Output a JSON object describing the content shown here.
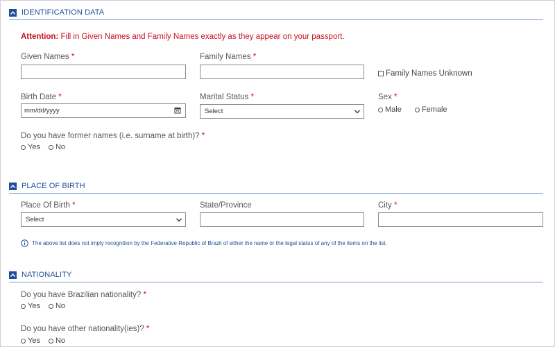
{
  "sections": {
    "identification": {
      "title": "IDENTIFICATION DATA"
    },
    "place_of_birth": {
      "title": "PLACE OF BIRTH"
    },
    "nationality": {
      "title": "NATIONALITY"
    }
  },
  "attention": {
    "label": "Attention:",
    "text": "Fill in Given Names and Family Names exactly as they appear on your passport."
  },
  "fields": {
    "given_names": {
      "label": "Given Names",
      "value": ""
    },
    "family_names": {
      "label": "Family Names",
      "value": ""
    },
    "family_names_unknown": {
      "label": "Family Names Unknown"
    },
    "birth_date": {
      "label": "Birth Date",
      "placeholder": "mm/dd/yyyy"
    },
    "marital_status": {
      "label": "Marital Status",
      "value": "Select"
    },
    "sex": {
      "label": "Sex",
      "options": [
        "Male",
        "Female"
      ]
    },
    "former_names": {
      "label": "Do you have former names (i.e. surname at birth)?",
      "options": [
        "Yes",
        "No"
      ]
    },
    "place_of_birth": {
      "label": "Place Of Birth",
      "value": "Select"
    },
    "state_province": {
      "label": "State/Province",
      "value": ""
    },
    "city": {
      "label": "City",
      "value": ""
    },
    "brazilian_nationality": {
      "label": "Do you have Brazilian nationality?",
      "options": [
        "Yes",
        "No"
      ]
    },
    "other_nationality": {
      "label": "Do you have other nationality(ies)?",
      "options": [
        "Yes",
        "No"
      ]
    }
  },
  "required_mark": "*",
  "info_note": "The above list does not imply recognition by the Federative Republic of Brazil of either the name or the legal status of any of the items on the list.",
  "colors": {
    "section_blue": "#1f4e9b",
    "required_red": "#c8101d",
    "info_blue": "#1f4e9b"
  },
  "icons": {
    "section_toggle": "chevron-up-icon",
    "select": "chevron-down-icon",
    "date": "calendar-icon",
    "info": "info-icon"
  }
}
